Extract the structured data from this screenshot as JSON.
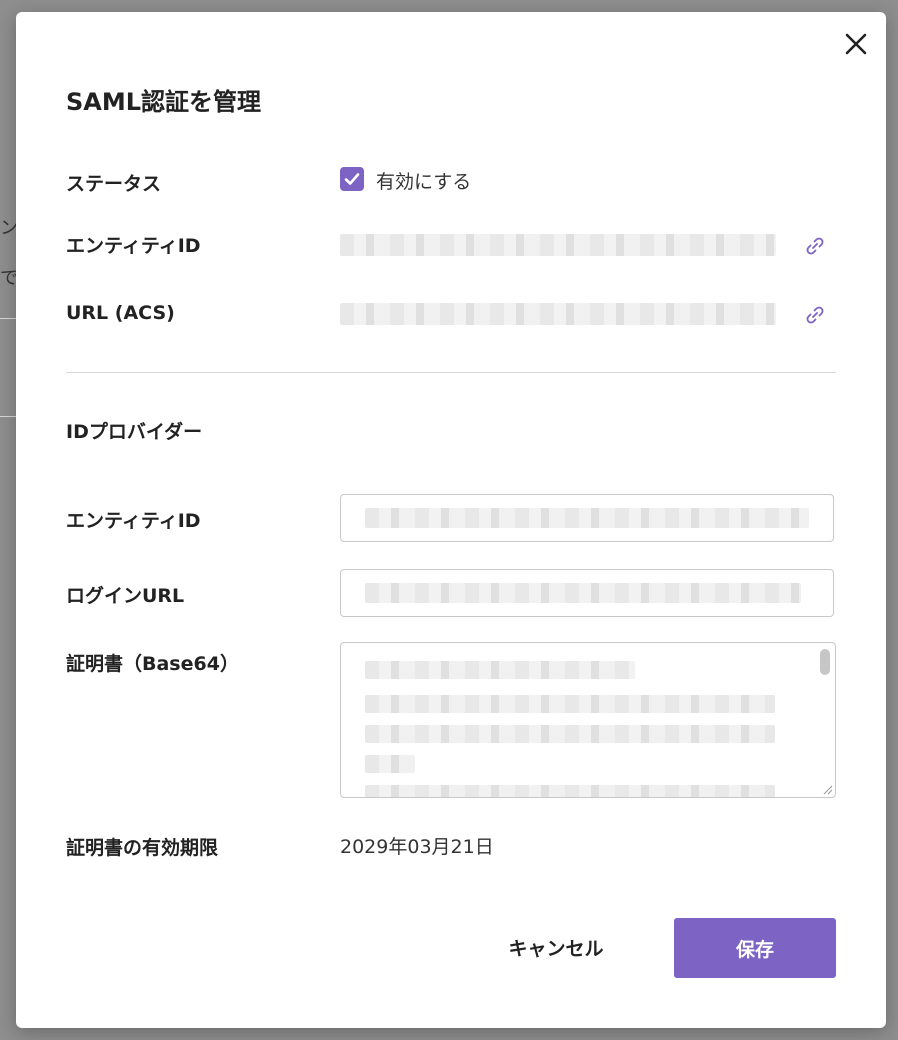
{
  "background": {
    "fragment_1": "ン",
    "fragment_2": "で"
  },
  "dialog": {
    "title": "SAML認証を管理",
    "status": {
      "label": "ステータス",
      "checkbox_label": "有効にする",
      "checked": true
    },
    "sp_entity_id": {
      "label": "エンティティID"
    },
    "acs_url": {
      "label": "URL (ACS)"
    },
    "idp_section_title": "IDプロバイダー",
    "idp_entity_id": {
      "label": "エンティティID"
    },
    "login_url": {
      "label": "ログインURL"
    },
    "certificate": {
      "label": "証明書（Base64）"
    },
    "expiry": {
      "label": "証明書の有効期限",
      "value": "2029年03月21日"
    },
    "buttons": {
      "cancel": "キャンセル",
      "save": "保存"
    }
  },
  "colors": {
    "accent": "#7c63c4",
    "link_icon": "#7c63c4"
  },
  "icons": {
    "close": "close-icon",
    "checkbox": "check-icon",
    "link": "link-icon"
  }
}
